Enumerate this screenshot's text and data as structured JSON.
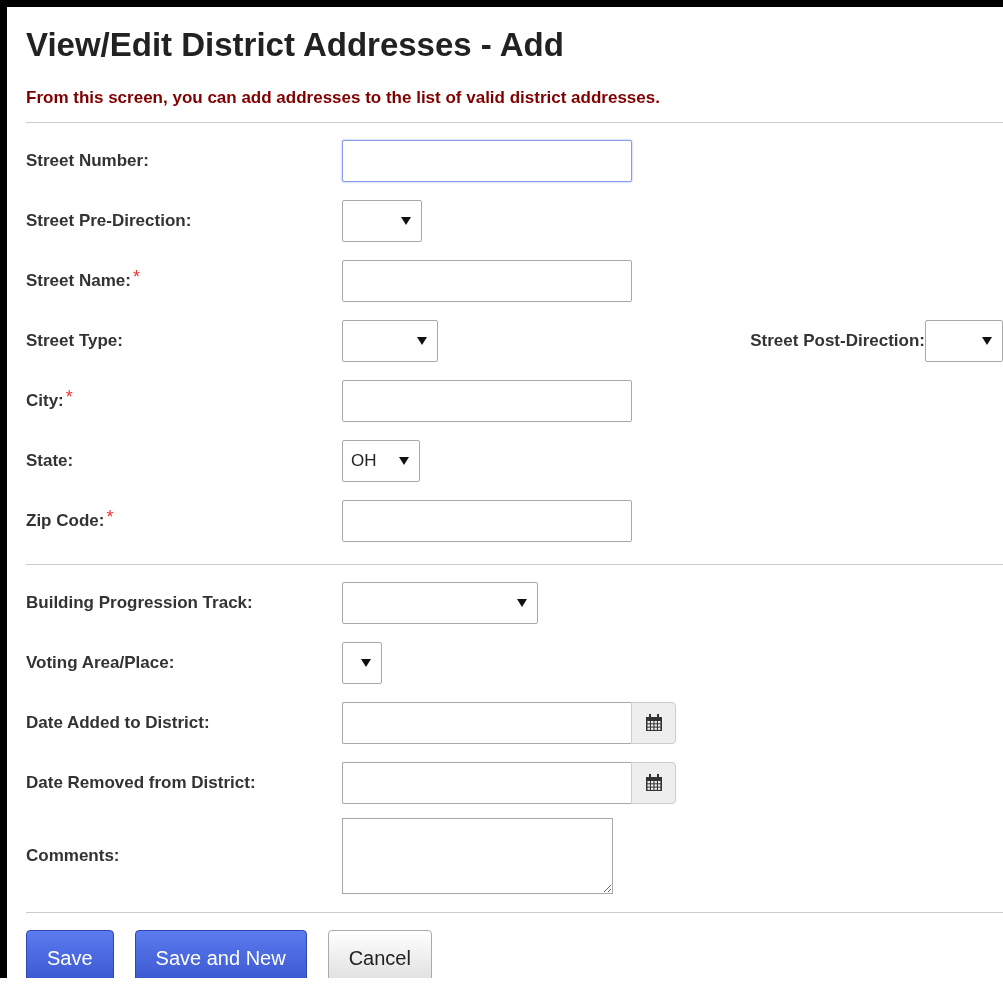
{
  "page": {
    "title": "View/Edit District Addresses - Add",
    "description": "From this screen, you can add addresses to the list of valid district addresses."
  },
  "sections": [
    {
      "fields": [
        {
          "label": "Street Number:",
          "kind": "text",
          "focused": true
        },
        {
          "label": "Street Pre-Direction:",
          "kind": "select"
        },
        {
          "label": "Street Name:",
          "kind": "text",
          "required_mark": "*",
          "focused": false
        },
        {
          "label": "Street Type:",
          "kind": "select",
          "extra": {
            "label": "Street Post-Direction:",
            "kind": "select"
          }
        },
        {
          "label": "City:",
          "kind": "text",
          "required_mark": "*",
          "focused": false
        },
        {
          "label": "State:",
          "kind": "select",
          "value": "OH"
        },
        {
          "label": "Zip Code:",
          "kind": "text",
          "required_mark": "*",
          "focused": false
        }
      ]
    },
    {
      "fields": [
        {
          "label": "Building Progression Track:",
          "kind": "select"
        },
        {
          "label": "Voting Area/Place:",
          "kind": "select"
        },
        {
          "label": "Date Added to District:",
          "kind": "date"
        },
        {
          "label": "Date Removed from District:",
          "kind": "date"
        },
        {
          "label": "Comments:",
          "kind": "textarea"
        }
      ]
    }
  ],
  "buttons": [
    {
      "label": "Save",
      "kind": "primary"
    },
    {
      "label": "Save and New",
      "kind": "primary"
    },
    {
      "label": "Cancel",
      "kind": "default"
    }
  ]
}
